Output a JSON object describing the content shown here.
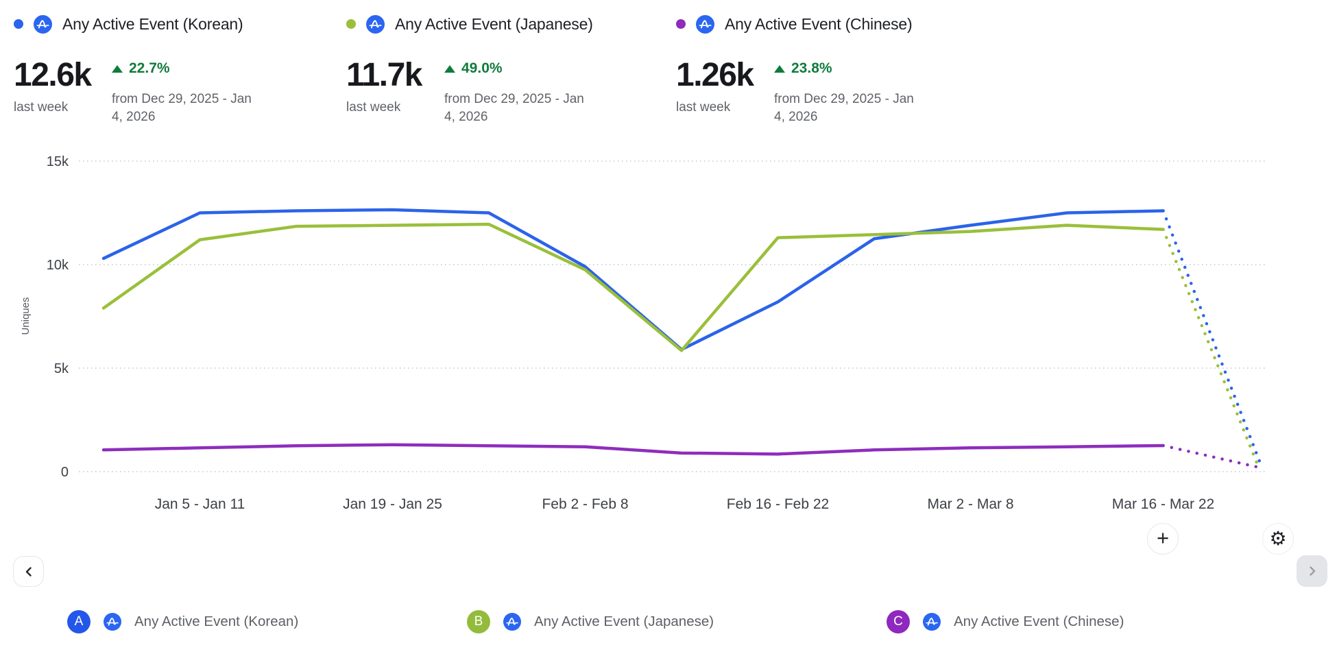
{
  "theme": {
    "positive": "#0f7b3c",
    "grid_color": "#c9ced6",
    "amp_icon_blue": "#2b66f0"
  },
  "header_metrics": [
    {
      "title": "Any Active Event (Korean)",
      "color": "#2b63e9",
      "value": "12.6k",
      "value_caption": "last week",
      "change_pct": "22.7%",
      "change_direction": "up",
      "change_caption": "from Dec 29, 2025 - Jan 4, 2026"
    },
    {
      "title": "Any Active Event (Japanese)",
      "color": "#9abf3b",
      "value": "11.7k",
      "value_caption": "last week",
      "change_pct": "49.0%",
      "change_direction": "up",
      "change_caption": "from Dec 29, 2025 - Jan 4, 2026"
    },
    {
      "title": "Any Active Event (Chinese)",
      "color": "#8e2dbd",
      "value": "1.26k",
      "value_caption": "last week",
      "change_pct": "23.8%",
      "change_direction": "up",
      "change_caption": "from Dec 29, 2025 - Jan 4, 2026"
    }
  ],
  "chart_data": {
    "type": "line",
    "ylabel": "Uniques",
    "ylim": [
      0,
      15000
    ],
    "ytick_values": [
      0,
      5000,
      10000,
      15000
    ],
    "ytick_labels": [
      "0",
      "5k",
      "10k",
      "15k"
    ],
    "x_tick_labels": [
      "Jan 5 - Jan 11",
      "Jan 19 - Jan 25",
      "Feb 2 - Feb 8",
      "Feb 16 - Feb 22",
      "Mar 2 - Mar 8",
      "Mar 16 - Mar 22"
    ],
    "x_tick_indices": [
      1,
      3,
      5,
      7,
      9,
      11
    ],
    "grid": "dotted-horizontal",
    "dashed_tail_points": 1,
    "series": [
      {
        "name": "Any Active Event (Korean)",
        "color": "#2b63e9",
        "values": [
          10300,
          12500,
          12600,
          12650,
          12500,
          9900,
          5900,
          8200,
          11250,
          11900,
          12500,
          12600,
          500
        ]
      },
      {
        "name": "Any Active Event (Japanese)",
        "color": "#9abf3b",
        "values": [
          7900,
          11200,
          11850,
          11900,
          11950,
          9750,
          5850,
          11300,
          11450,
          11600,
          11900,
          11700,
          100
        ]
      },
      {
        "name": "Any Active Event (Chinese)",
        "color": "#8e2dbd",
        "values": [
          1050,
          1150,
          1250,
          1300,
          1250,
          1200,
          900,
          850,
          1050,
          1150,
          1200,
          1260,
          200
        ]
      }
    ]
  },
  "legend": [
    {
      "letter": "A",
      "badge_color": "#2457e9",
      "label": "Any Active Event (Korean)"
    },
    {
      "letter": "B",
      "badge_color": "#93bb3c",
      "label": "Any Active Event (Japanese)"
    },
    {
      "letter": "C",
      "badge_color": "#8e28bf",
      "label": "Any Active Event (Chinese)"
    }
  ],
  "controls": {
    "plus": "+",
    "gear": "⚙"
  }
}
